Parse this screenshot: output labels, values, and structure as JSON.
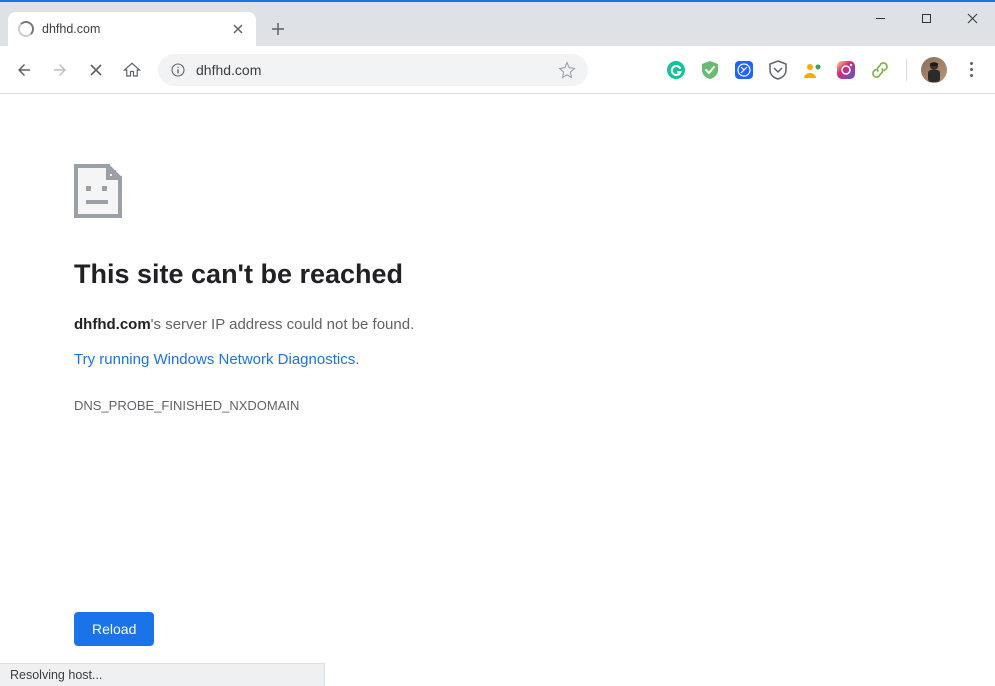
{
  "tab": {
    "title": "dhfhd.com"
  },
  "omnibox": {
    "url": "dhfhd.com"
  },
  "error": {
    "title": "This site can't be reached",
    "domain": "dhfhd.com",
    "desc_suffix": "'s server IP address could not be found.",
    "diag_link": "Try running Windows Network Diagnostics",
    "diag_period": ".",
    "code": "DNS_PROBE_FINISHED_NXDOMAIN",
    "reload_label": "Reload"
  },
  "status": {
    "text": "Resolving host..."
  }
}
